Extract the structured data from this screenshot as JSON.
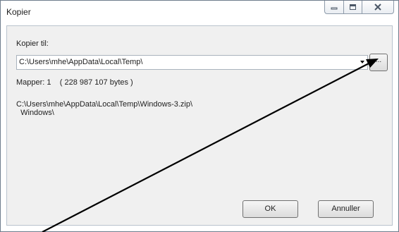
{
  "window": {
    "title": "Kopier"
  },
  "form": {
    "copy_to_label": "Kopier til:",
    "path_value": "C:\\Users\\mhe\\AppData\\Local\\Temp\\",
    "browse_label": "...",
    "folders_text": "Mapper: 1    ( 228 987 107 bytes )",
    "source_line_1": "C:\\Users\\mhe\\AppData\\Local\\Temp\\Windows-3.zip\\",
    "source_line_2": "  Windows\\"
  },
  "buttons": {
    "ok": "OK",
    "cancel": "Annuller"
  },
  "icons": {
    "minimize": "minimize-icon",
    "maximize": "maximize-icon",
    "close": "close-icon",
    "dropdown": "chevron-down-icon",
    "annotation": "arrow-annotation-icon"
  }
}
